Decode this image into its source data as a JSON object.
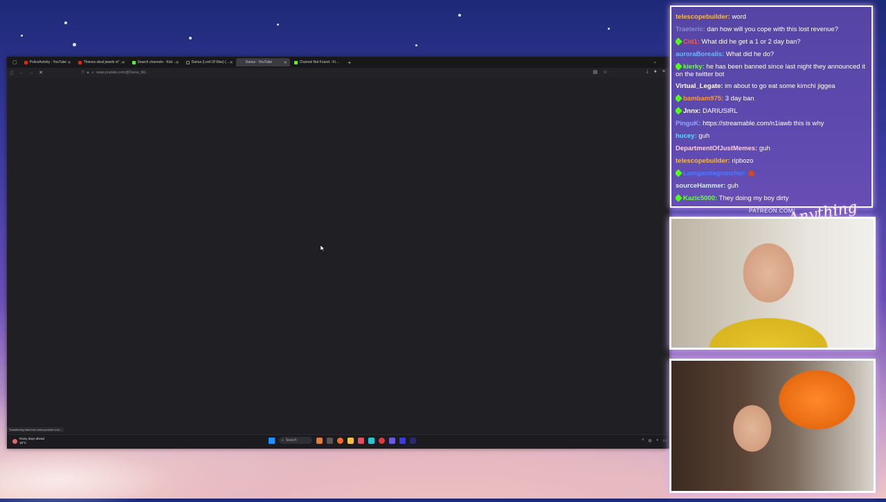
{
  "browser": {
    "tabs": [
      {
        "label": "PoliceActivity - YouTube",
        "favicon": "youtube",
        "active": false
      },
      {
        "label": "Thieves steal jewels of 'incalcul",
        "favicon": "youtube",
        "active": false
      },
      {
        "label": "Search channels - Kick Streamin",
        "favicon": "kick",
        "active": false
      },
      {
        "label": "Darius (Lord Of Wax) (@IRL_Da",
        "favicon": "none",
        "active": false
      },
      {
        "label": "Darius - YouTube",
        "favicon": "none",
        "active": true
      },
      {
        "label": "Channel Not Found - Kick Strea",
        "favicon": "kick",
        "active": false
      }
    ],
    "url": "www.youtube.com/@Darius_IRL",
    "status_text": "Transferring data from www.youtube.com..."
  },
  "taskbar": {
    "weather_line1": "Rainy days ahead",
    "weather_line2": "18°C",
    "search_placeholder": "Search"
  },
  "chat": {
    "messages": [
      {
        "user": "telescopebuilder",
        "color": "#f5b94a",
        "badge": false,
        "text": "word"
      },
      {
        "user": "Traeteric",
        "color": "#8a8ad9",
        "badge": false,
        "text": "dan how will you cope with this lost revenue?"
      },
      {
        "user": "Cid1",
        "color": "#ff5a3a",
        "badge": true,
        "text": "What did he get a 1 or 2 day ban?"
      },
      {
        "user": "auroraBorealis",
        "color": "#6fb7ff",
        "badge": false,
        "text": "What did he do?"
      },
      {
        "user": "kierky",
        "color": "#6bff4a",
        "badge": true,
        "text": "he has been banned since last night they announced it on the twitter bot"
      },
      {
        "user": "Virtual_Legate",
        "color": "#ffffff",
        "badge": false,
        "text": "im about to go eat some kimchi jiggea"
      },
      {
        "user": "bambam975",
        "color": "#ff9a2a",
        "badge": true,
        "text": "3 day ban"
      },
      {
        "user": "Jnnx",
        "color": "#ffffff",
        "badge": true,
        "text": "DARIUSIRL"
      },
      {
        "user": "PinguK",
        "color": "#8fa8ff",
        "badge": false,
        "text": "https://streamable.com/n1iawb this is why"
      },
      {
        "user": "hucey",
        "color": "#5fd8ff",
        "badge": false,
        "text": "guh"
      },
      {
        "user": "DepartmentOfJustMemes",
        "color": "#ffd0e8",
        "badge": false,
        "text": "guh"
      },
      {
        "user": "telescopebuilder",
        "color": "#f5b94a",
        "badge": false,
        "text": "ripbozo"
      },
      {
        "user": "Lamgandagrancher",
        "color": "#4a7cff",
        "badge": true,
        "text": ""
      },
      {
        "user": "sourceHammer",
        "color": "#d8e8ff",
        "badge": false,
        "text": "guh"
      },
      {
        "user": "Kazic5000",
        "color": "#6bff4a",
        "badge": true,
        "text": "They doing my boy dirty"
      }
    ]
  },
  "overlay": {
    "patreon": "PATREON.COM/",
    "logo": "Anything Else"
  }
}
